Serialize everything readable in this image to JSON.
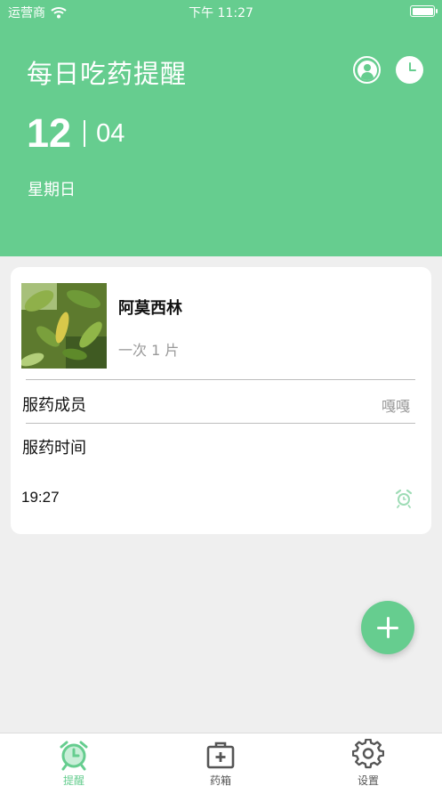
{
  "status_bar": {
    "carrier": "运营商",
    "time": "下午 11:27"
  },
  "header": {
    "title": "每日吃药提醒",
    "month": "12",
    "day": "04",
    "weekday": "星期日"
  },
  "reminder": {
    "medicine_name": "阿莫西林",
    "dosage": "一次 1 片",
    "member_label": "服药成员",
    "member_value": "嘎嘎",
    "time_label": "服药时间",
    "time_value": "19:27"
  },
  "tabbar": {
    "items": [
      {
        "label": "提醒",
        "icon": "alarm-clock-icon",
        "active": true
      },
      {
        "label": "药箱",
        "icon": "medicine-box-icon",
        "active": false
      },
      {
        "label": "设置",
        "icon": "gear-icon",
        "active": false
      }
    ]
  },
  "colors": {
    "accent": "#66cd8f",
    "background": "#efefef"
  }
}
